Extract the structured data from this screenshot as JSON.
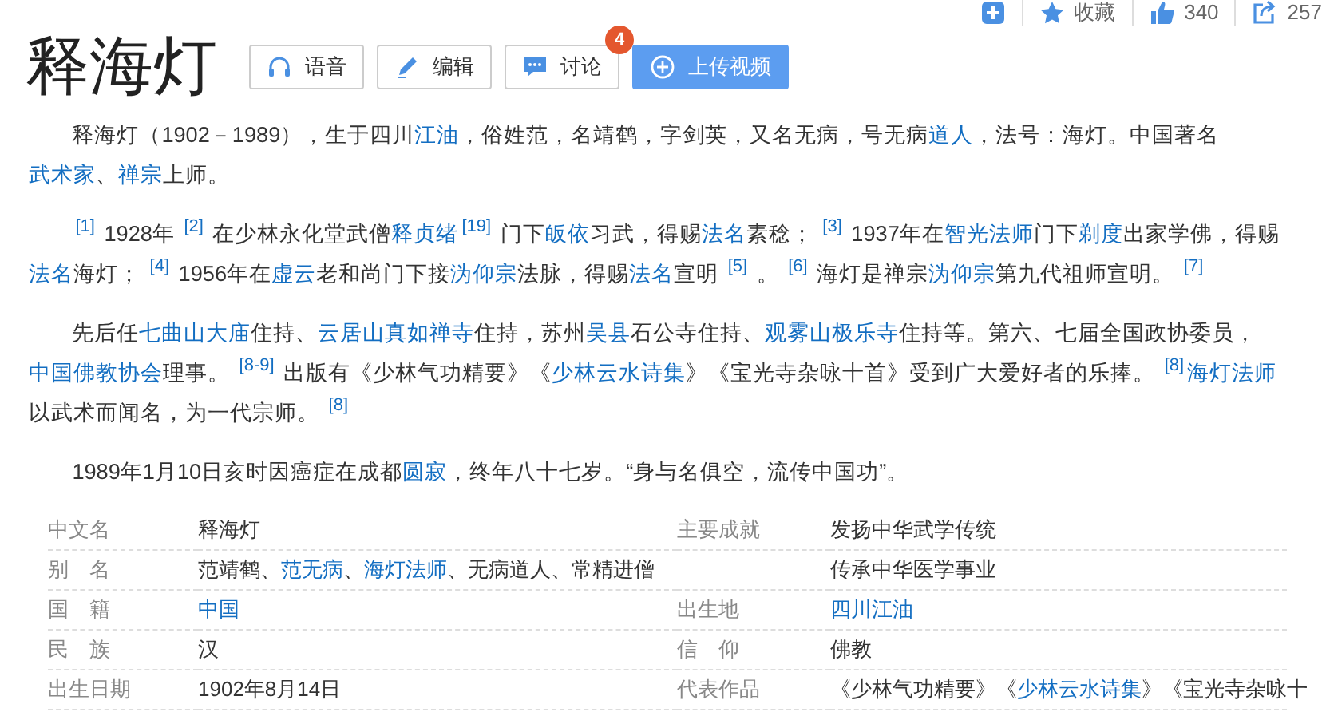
{
  "toolbar": [
    {
      "kind": "add"
    },
    {
      "kind": "star",
      "label": "收藏"
    },
    {
      "kind": "like",
      "label": "340"
    },
    {
      "kind": "share",
      "label": "257"
    }
  ],
  "title": "释海灯",
  "actions": [
    {
      "kind": "headphones",
      "label": "语音",
      "primary": false
    },
    {
      "kind": "pencil",
      "label": "编辑",
      "primary": false
    },
    {
      "kind": "chat",
      "label": "讨论",
      "primary": false,
      "badge": "4"
    },
    {
      "kind": "plus",
      "label": "上传视频",
      "primary": true
    }
  ],
  "paragraphs": [
    [
      {
        "kind": "text",
        "text": "释海灯（1902－1989），生于四川"
      },
      {
        "kind": "link",
        "text": "江油"
      },
      {
        "kind": "text",
        "text": "，俗姓范，名靖鹤，字剑英，又名无病，号无病"
      },
      {
        "kind": "link",
        "text": "道人"
      },
      {
        "kind": "text",
        "text": "，法号：海灯。中国著名"
      },
      {
        "kind": "link",
        "text": "武术家"
      },
      {
        "kind": "text",
        "text": "、"
      },
      {
        "kind": "link",
        "text": "禅宗"
      },
      {
        "kind": "text",
        "text": "上师。"
      }
    ],
    [
      {
        "kind": "ref",
        "text": "[1]"
      },
      {
        "kind": "text",
        "text": " 1928年 "
      },
      {
        "kind": "ref",
        "text": "[2]"
      },
      {
        "kind": "text",
        "text": " 在少林永化堂武僧"
      },
      {
        "kind": "link",
        "text": "释贞绪"
      },
      {
        "kind": "ref",
        "text": "[19]"
      },
      {
        "kind": "text",
        "text": " 门下"
      },
      {
        "kind": "link",
        "text": "皈依"
      },
      {
        "kind": "text",
        "text": "习武，得赐"
      },
      {
        "kind": "link",
        "text": "法名"
      },
      {
        "kind": "text",
        "text": "素稔； "
      },
      {
        "kind": "ref",
        "text": "[3]"
      },
      {
        "kind": "text",
        "text": " 1937年在"
      },
      {
        "kind": "link",
        "text": "智光法师"
      },
      {
        "kind": "text",
        "text": "门下"
      },
      {
        "kind": "link",
        "text": "剃度"
      },
      {
        "kind": "text",
        "text": "出家学佛，得赐"
      },
      {
        "kind": "link",
        "text": "法名"
      },
      {
        "kind": "text",
        "text": "海灯； "
      },
      {
        "kind": "ref",
        "text": "[4]"
      },
      {
        "kind": "text",
        "text": " 1956年在"
      },
      {
        "kind": "link",
        "text": "虚云"
      },
      {
        "kind": "text",
        "text": "老和尚门下接"
      },
      {
        "kind": "link",
        "text": "沩仰宗"
      },
      {
        "kind": "text",
        "text": "法脉，得赐"
      },
      {
        "kind": "link",
        "text": "法名"
      },
      {
        "kind": "text",
        "text": "宣明 "
      },
      {
        "kind": "ref",
        "text": "[5]"
      },
      {
        "kind": "text",
        "text": " 。 "
      },
      {
        "kind": "ref",
        "text": "[6]"
      },
      {
        "kind": "text",
        "text": " 海灯是禅宗"
      },
      {
        "kind": "link",
        "text": "沩仰宗"
      },
      {
        "kind": "text",
        "text": "第九代祖师宣明。 "
      },
      {
        "kind": "ref",
        "text": "[7]"
      }
    ],
    [
      {
        "kind": "text",
        "text": "先后任"
      },
      {
        "kind": "link",
        "text": "七曲山大庙"
      },
      {
        "kind": "text",
        "text": "住持、"
      },
      {
        "kind": "link",
        "text": "云居山真如禅寺"
      },
      {
        "kind": "text",
        "text": "住持，苏州"
      },
      {
        "kind": "link",
        "text": "吴县"
      },
      {
        "kind": "text",
        "text": "石公寺住持、"
      },
      {
        "kind": "link",
        "text": "观雾山极乐寺"
      },
      {
        "kind": "text",
        "text": "住持等。第六、七届全国政协委员，"
      },
      {
        "kind": "link",
        "text": "中国佛教协会"
      },
      {
        "kind": "text",
        "text": "理事。 "
      },
      {
        "kind": "ref",
        "text": "[8-9]"
      },
      {
        "kind": "text",
        "text": " 出版有《少林气功精要》《"
      },
      {
        "kind": "link",
        "text": "少林云水诗集"
      },
      {
        "kind": "text",
        "text": "》《宝光寺杂咏十首》受到广大爱好者的乐捧。 "
      },
      {
        "kind": "ref",
        "text": "[8]"
      },
      {
        "kind": "link",
        "text": "海灯法师"
      },
      {
        "kind": "text",
        "text": "以武术而闻名，为一代宗师。 "
      },
      {
        "kind": "ref",
        "text": "[8]"
      }
    ],
    [
      {
        "kind": "text",
        "text": "1989年1月10日亥时因癌症在成都"
      },
      {
        "kind": "link",
        "text": "圆寂"
      },
      {
        "kind": "text",
        "text": "，终年八十七岁。“身与名俱空，流传中国功”。"
      }
    ]
  ],
  "infobox": [
    {
      "label_1": "中文名",
      "value_1": [
        {
          "kind": "text",
          "text": "释海灯"
        }
      ],
      "label_2": "主要成就",
      "value_2": [
        {
          "kind": "text",
          "text": "发扬中华武学传统"
        }
      ]
    },
    {
      "label_1": "别名",
      "value_1": [
        {
          "kind": "text",
          "text": "范靖鹤、"
        },
        {
          "kind": "link",
          "text": "范无病"
        },
        {
          "kind": "text",
          "text": "、"
        },
        {
          "kind": "link",
          "text": "海灯法师"
        },
        {
          "kind": "text",
          "text": "、无病道人、常精进僧"
        }
      ],
      "value_2": [
        {
          "kind": "text",
          "text": "传承中华医学事业"
        }
      ]
    },
    {
      "label_1": "国籍",
      "value_1": [
        {
          "kind": "link",
          "text": "中国"
        }
      ],
      "label_2": "出生地",
      "value_2": [
        {
          "kind": "link",
          "text": "四川江油"
        }
      ]
    },
    {
      "label_1": "民族",
      "value_1": [
        {
          "kind": "text",
          "text": "汉"
        }
      ],
      "label_2": "信仰",
      "value_2": [
        {
          "kind": "text",
          "text": "佛教"
        }
      ]
    },
    {
      "label_1": "出生日期",
      "value_1": [
        {
          "kind": "text",
          "text": "1902年8月14日"
        }
      ],
      "label_2": "代表作品",
      "value_2": [
        {
          "kind": "text",
          "text": "《少林气功精要》《"
        },
        {
          "kind": "link",
          "text": "少林云水诗集"
        },
        {
          "kind": "text",
          "text": "》《宝光寺杂咏十"
        }
      ]
    }
  ]
}
